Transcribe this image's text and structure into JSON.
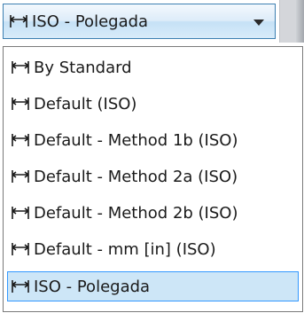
{
  "combo": {
    "selected_value": "ISO - Polegada",
    "icon": "dimension-style-icon"
  },
  "dropdown": {
    "items": [
      {
        "label": "By Standard",
        "icon": "dimension-style-icon",
        "selected": false
      },
      {
        "label": "Default (ISO)",
        "icon": "dimension-style-icon",
        "selected": false
      },
      {
        "label": "Default - Method 1b (ISO)",
        "icon": "dimension-style-icon",
        "selected": false
      },
      {
        "label": "Default - Method 2a (ISO)",
        "icon": "dimension-style-icon",
        "selected": false
      },
      {
        "label": "Default - Method 2b (ISO)",
        "icon": "dimension-style-icon",
        "selected": false
      },
      {
        "label": "Default - mm [in] (ISO)",
        "icon": "dimension-style-icon",
        "selected": false
      },
      {
        "label": "ISO - Polegada",
        "icon": "dimension-style-icon",
        "selected": true
      }
    ]
  },
  "colors": {
    "combo_border": "#3c7fb1",
    "selection_fill": "#cde6f7",
    "selection_border": "#3399ff",
    "text": "#1a1a1a"
  }
}
